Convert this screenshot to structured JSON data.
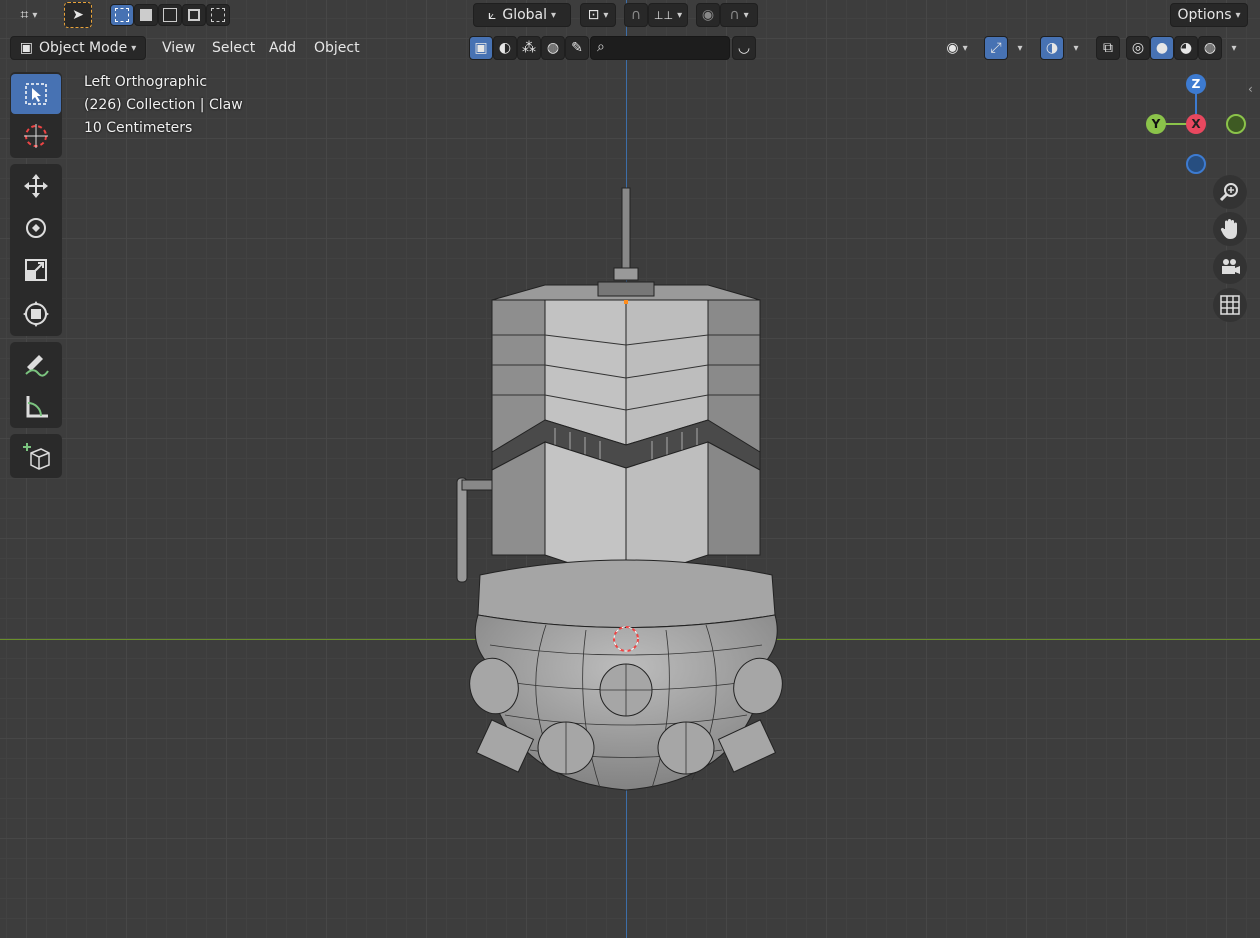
{
  "topbar": {
    "orientation_label": "Global",
    "options_label": "Options"
  },
  "header": {
    "mode_label": "Object Mode",
    "menu": [
      "View",
      "Select",
      "Add",
      "Object"
    ],
    "search_placeholder": ""
  },
  "overlay": {
    "view_name": "Left Orthographic",
    "collection_info": "(226) Collection | Claw",
    "scale_info": "10 Centimeters"
  },
  "gizmo": {
    "z_label": "Z",
    "y_label": "Y",
    "x_label": "X",
    "colors": {
      "x": "#e8485f",
      "y": "#8bc34a",
      "z": "#3d7bd1"
    }
  },
  "tools": [
    "select-box-icon",
    "cursor-icon",
    "move-icon",
    "rotate-icon",
    "scale-icon",
    "transform-icon",
    "annotate-icon",
    "measure-icon",
    "add-cube-icon"
  ],
  "nav": [
    "zoom-icon",
    "pan-hand-icon",
    "camera-icon",
    "grid-icon"
  ],
  "accent_color": "#4772b3"
}
